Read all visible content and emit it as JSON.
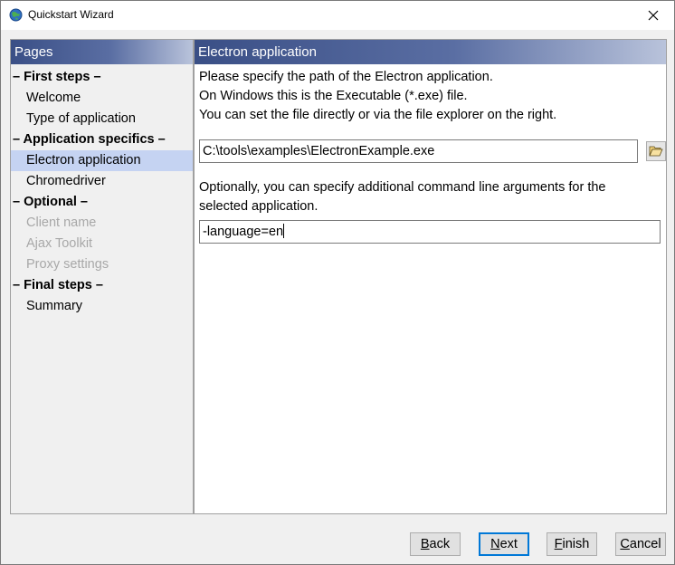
{
  "window": {
    "title": "Quickstart Wizard"
  },
  "pages_panel": {
    "header": "Pages",
    "items": [
      {
        "kind": "section",
        "label": "– First steps –"
      },
      {
        "kind": "page",
        "label": "Welcome",
        "state": "normal"
      },
      {
        "kind": "page",
        "label": "Type of application",
        "state": "normal"
      },
      {
        "kind": "section",
        "label": "– Application specifics –"
      },
      {
        "kind": "page",
        "label": "Electron application",
        "state": "selected"
      },
      {
        "kind": "page",
        "label": "Chromedriver",
        "state": "normal"
      },
      {
        "kind": "section",
        "label": "– Optional –"
      },
      {
        "kind": "page",
        "label": "Client name",
        "state": "disabled"
      },
      {
        "kind": "page",
        "label": "Ajax Toolkit",
        "state": "disabled"
      },
      {
        "kind": "page",
        "label": "Proxy settings",
        "state": "disabled"
      },
      {
        "kind": "section",
        "label": "– Final steps –"
      },
      {
        "kind": "page",
        "label": "Summary",
        "state": "normal"
      }
    ]
  },
  "content": {
    "header": "Electron application",
    "intro_lines": [
      "Please specify the path of the Electron application.",
      "On Windows this is the Executable (*.exe) file.",
      "You can set the file directly or via the file explorer on the right."
    ],
    "path_value": "C:\\tools\\examples\\ElectronExample.exe",
    "args_lines": [
      "Optionally, you can specify additional command line arguments for the",
      "selected application."
    ],
    "args_value": "-language=en"
  },
  "buttons": {
    "back": {
      "mnemonic": "B",
      "rest": "ack"
    },
    "next": {
      "mnemonic": "N",
      "rest": "ext"
    },
    "finish": {
      "mnemonic": "F",
      "rest": "inish"
    },
    "cancel": {
      "mnemonic": "C",
      "rest": "ancel"
    }
  },
  "icons": {
    "app": "globe-icon",
    "close": "close-icon",
    "browse": "folder-open-icon"
  },
  "colors": {
    "selection": "#c5d3f2",
    "header_start": "#3a4f86",
    "header_end": "#b9c3db",
    "default_button_border": "#0078d7"
  }
}
